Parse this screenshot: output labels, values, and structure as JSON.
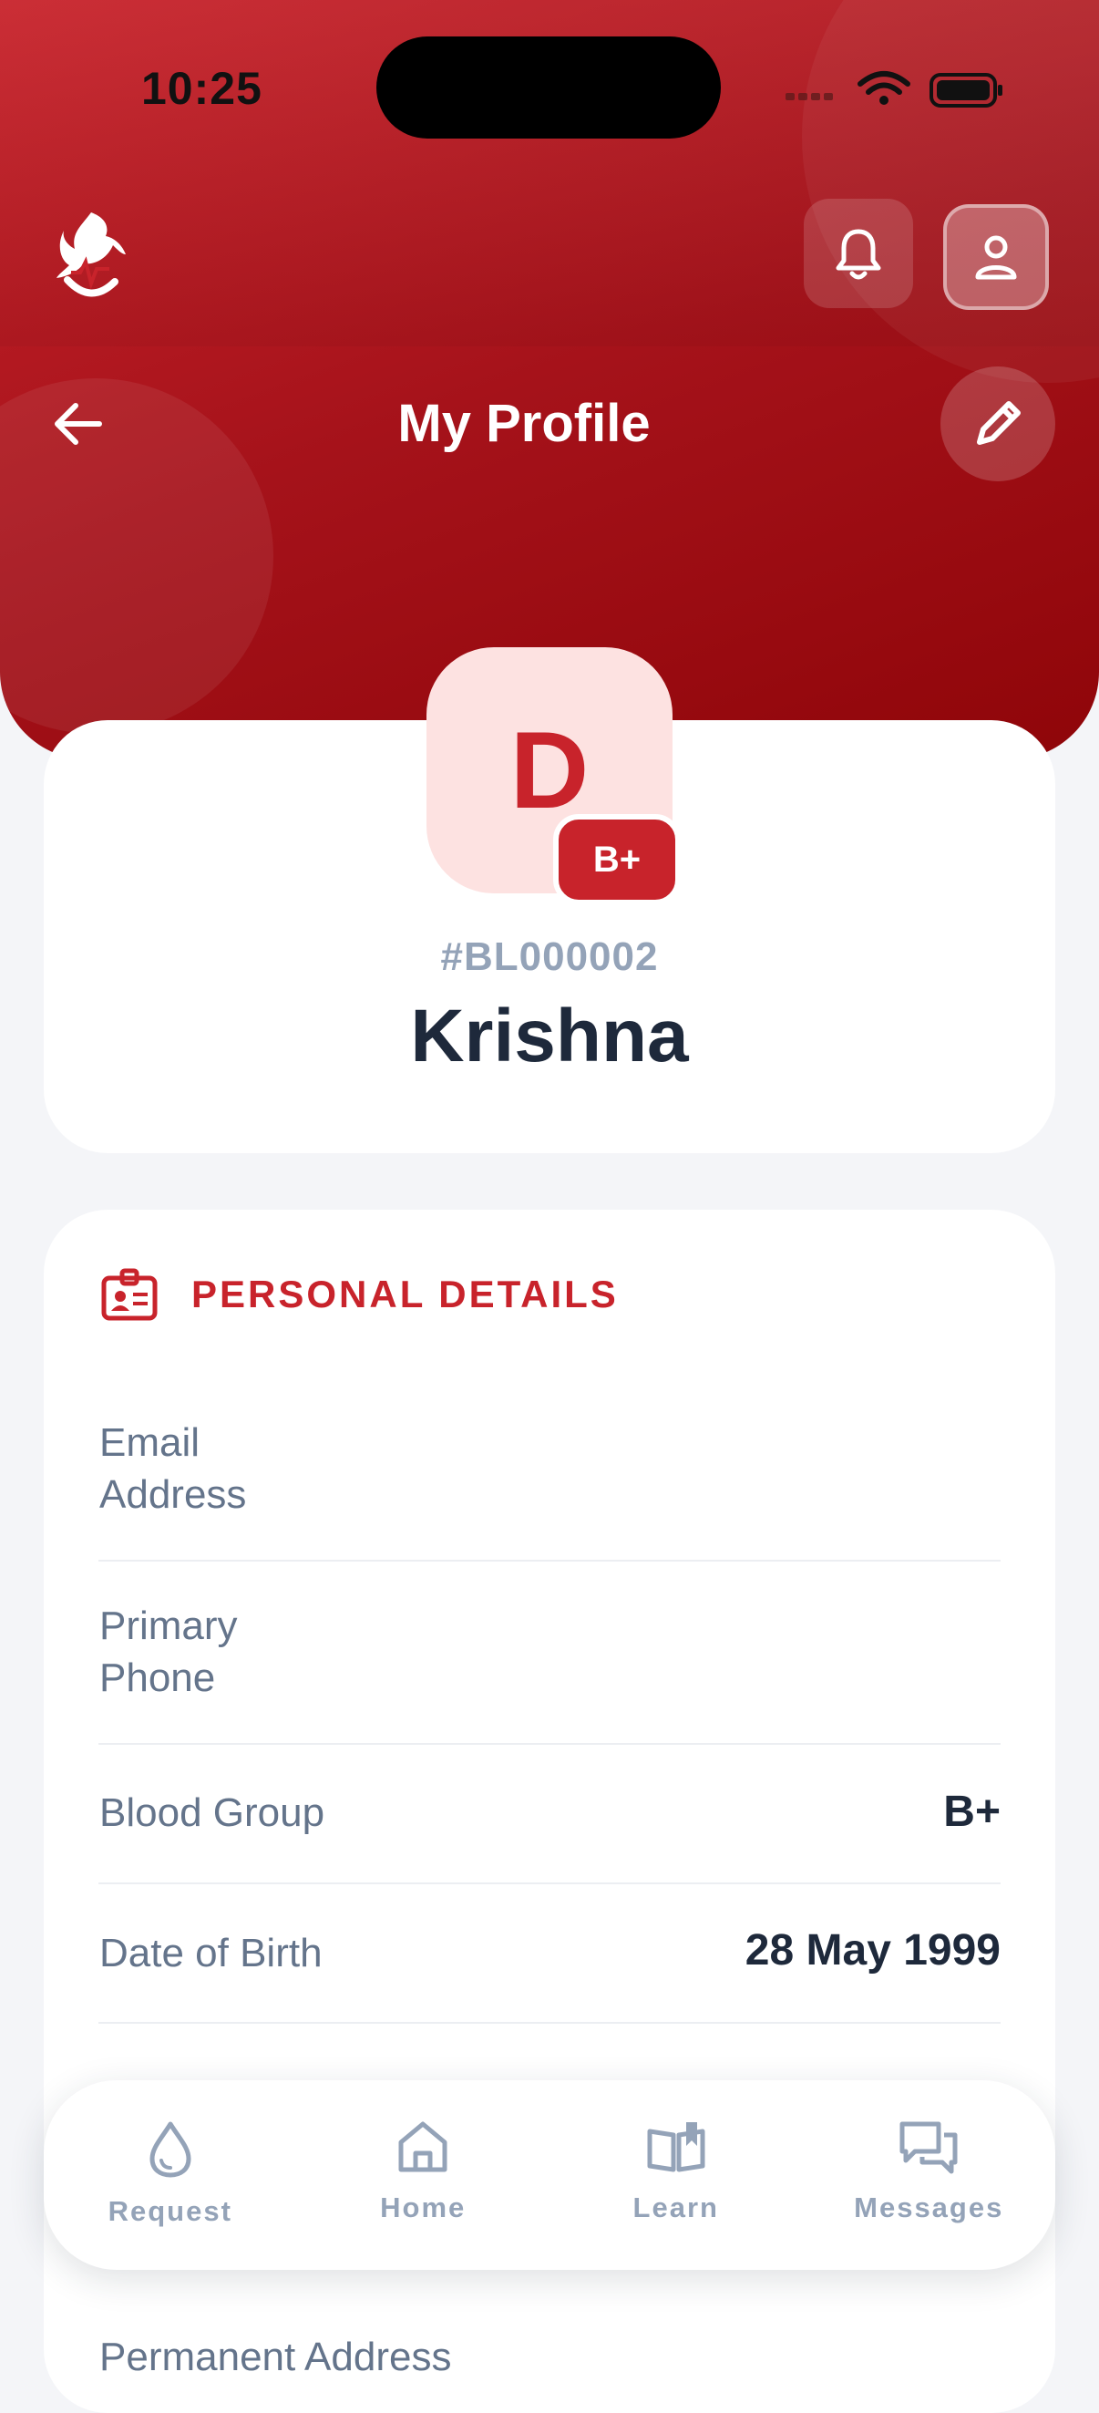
{
  "status_bar": {
    "time": "10:25"
  },
  "header": {
    "title": "My Profile"
  },
  "profile": {
    "initial": "D",
    "blood_group_badge": "B+",
    "id": "#BL000002",
    "name": "Krishna"
  },
  "personal_details": {
    "title": "PERSONAL DETAILS",
    "rows": [
      {
        "label": "Email\nAddress",
        "value": ""
      },
      {
        "label": "Primary\nPhone",
        "value": ""
      },
      {
        "label": "Blood Group",
        "value": "B+"
      },
      {
        "label": "Date of Birth",
        "value": "28 May 1999"
      },
      {
        "label": "Permanent Address",
        "value": ""
      }
    ]
  },
  "bottom_nav": {
    "items": [
      {
        "label": "Request",
        "icon": "drop-icon"
      },
      {
        "label": "Home",
        "icon": "home-icon"
      },
      {
        "label": "Learn",
        "icon": "book-icon"
      },
      {
        "label": "Messages",
        "icon": "chat-icon"
      }
    ]
  },
  "colors": {
    "brand_red": "#c8232b",
    "header_dark": "#8f0509",
    "avatar_bg": "#fde2e1",
    "muted": "#94a3b8"
  }
}
